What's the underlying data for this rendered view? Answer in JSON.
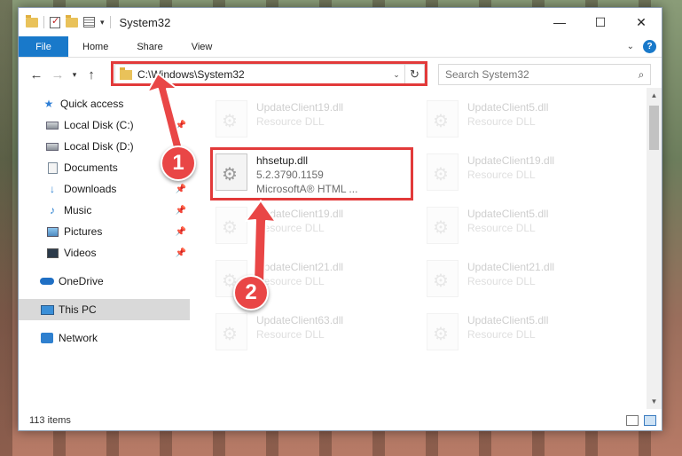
{
  "window": {
    "title": "System32",
    "controls": {
      "minimize": "—",
      "maximize": "☐",
      "close": "✕"
    }
  },
  "ribbon": {
    "tabs": [
      "File",
      "Home",
      "Share",
      "View"
    ],
    "help": "?"
  },
  "address": {
    "path": "C:\\Windows\\System32"
  },
  "search": {
    "placeholder": "Search System32"
  },
  "sidebar": {
    "items": [
      {
        "label": "Quick access",
        "icon": "star-icon"
      },
      {
        "label": "Local Disk (C:)",
        "icon": "disk-icon",
        "pinned": true
      },
      {
        "label": "Local Disk (D:)",
        "icon": "disk-icon"
      },
      {
        "label": "Documents",
        "icon": "documents-icon"
      },
      {
        "label": "Downloads",
        "icon": "download-icon",
        "pinned": true
      },
      {
        "label": "Music",
        "icon": "music-icon",
        "pinned": true
      },
      {
        "label": "Pictures",
        "icon": "pictures-icon",
        "pinned": true
      },
      {
        "label": "Videos",
        "icon": "videos-icon",
        "pinned": true
      },
      {
        "label": "OneDrive",
        "icon": "onedrive-icon"
      },
      {
        "label": "This PC",
        "icon": "pc-icon",
        "selected": true
      },
      {
        "label": "Network",
        "icon": "network-icon"
      }
    ]
  },
  "files": {
    "highlighted": {
      "name": "hhsetup.dll",
      "version": "5.2.3790.1159",
      "description": "MicrosoftA® HTML ..."
    },
    "faded": [
      {
        "name": "UpdateClient19.dll",
        "desc": "Resource DLL"
      },
      {
        "name": "UpdateClient5.dll",
        "desc": "Resource DLL"
      },
      {
        "name": "UpdateClient19.dll",
        "desc": "Resource DLL"
      },
      {
        "name": "UpdateClient19.dll",
        "desc": "Resource DLL"
      },
      {
        "name": "UpdateClient5.dll",
        "desc": "Resource DLL"
      },
      {
        "name": "UpdateClient21.dll",
        "desc": "Resource DLL"
      },
      {
        "name": "UpdateClient21.dll",
        "desc": "Resource DLL"
      },
      {
        "name": "UpdateClient63.dll",
        "desc": "Resource DLL"
      },
      {
        "name": "UpdateClient5.dll",
        "desc": "Resource DLL"
      }
    ]
  },
  "status": {
    "item_count": "113 items"
  },
  "callouts": {
    "one": "1",
    "two": "2"
  },
  "colors": {
    "accent": "#1979ca",
    "highlight": "#e23a3a",
    "callout": "#e94646"
  }
}
